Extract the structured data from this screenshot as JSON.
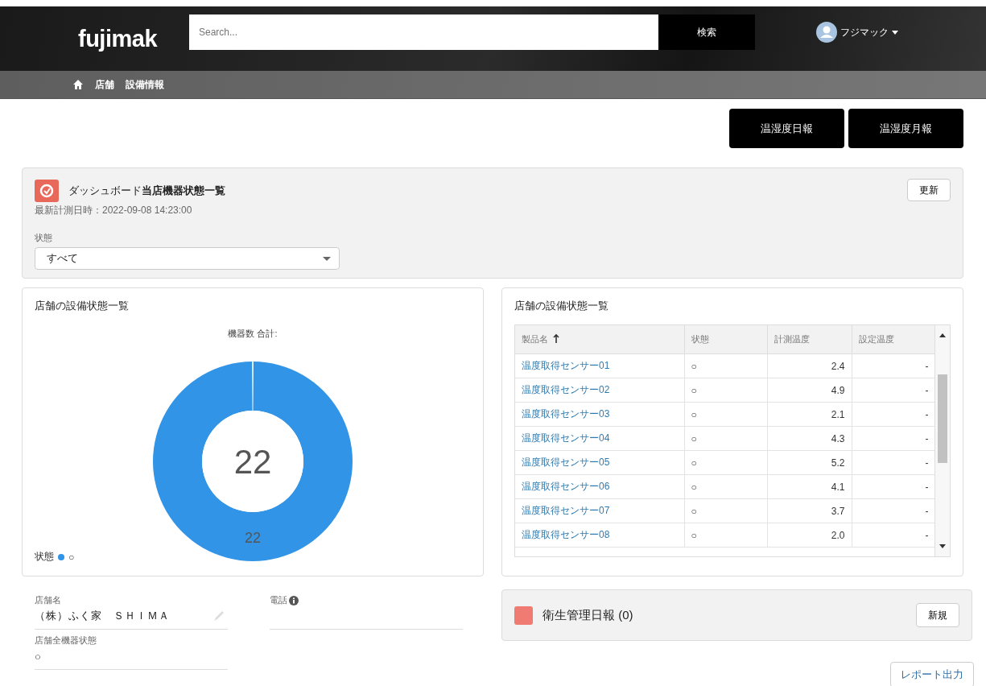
{
  "header": {
    "logo": "fujimak",
    "search": {
      "placeholder": "Search..."
    },
    "search_button": "検索",
    "user": {
      "name": "フジマック"
    }
  },
  "breadcrumbs": [
    "店舗",
    "設備情報"
  ],
  "report_buttons": [
    "温湿度日報",
    "温湿度月報"
  ],
  "dashboard": {
    "title": "ダッシュボード**当店機器状態一覧**",
    "measured": "最新計測日時：2022-09-08 14:23:00",
    "refresh_button": "更新",
    "filter": {
      "label": "状態",
      "value": "すべて"
    }
  },
  "chart_card": {
    "title": "店舗の設備状態一覧",
    "center_value": "22",
    "legend": {
      "title": "状態"
    },
    "chart_data": {
      "type": "donut",
      "title": "機器数 合計:",
      "categories": [
        "○"
      ],
      "series": [
        {
          "color": "#3294e6",
          "values": [
            22
          ]
        }
      ],
      "data_labels": true
    }
  },
  "table_card": {
    "title": "店舗の設備状態一覧",
    "columns": [
      {
        "label": "製品名",
        "sorted": true
      },
      {
        "label": "状態",
        "sorted": false
      },
      {
        "label": "計測温度",
        "sorted": false
      },
      {
        "label": "設定温度",
        "sorted": false
      }
    ],
    "rows": [
      [
        "温度取得センサー01",
        "○",
        "2.4",
        "-"
      ],
      [
        "温度取得センサー02",
        "○",
        "4.9",
        "-"
      ],
      [
        "温度取得センサー03",
        "○",
        "2.1",
        "-"
      ],
      [
        "温度取得センサー04",
        "○",
        "4.3",
        "-"
      ],
      [
        "温度取得センサー05",
        "○",
        "5.2",
        "-"
      ],
      [
        "温度取得センサー06",
        "○",
        "4.1",
        "-"
      ],
      [
        "温度取得センサー07",
        "○",
        "3.7",
        "-"
      ],
      [
        "温度取得センサー08",
        "○",
        "2.0",
        "-"
      ]
    ]
  },
  "store_fields": [
    {
      "label": "店舗名",
      "value": "（株）ふく家　ＳＨＩＭＡ",
      "editable": true,
      "info": false
    },
    {
      "label": "電話",
      "editable": false,
      "info": true
    },
    {
      "label": "店舗全機器状態",
      "value": "○",
      "editable": false,
      "info": false
    }
  ],
  "hygiene": {
    "title": "衛生管理日報 (0)",
    "new_button": "新規"
  },
  "report_export_button": "レポート出力"
}
